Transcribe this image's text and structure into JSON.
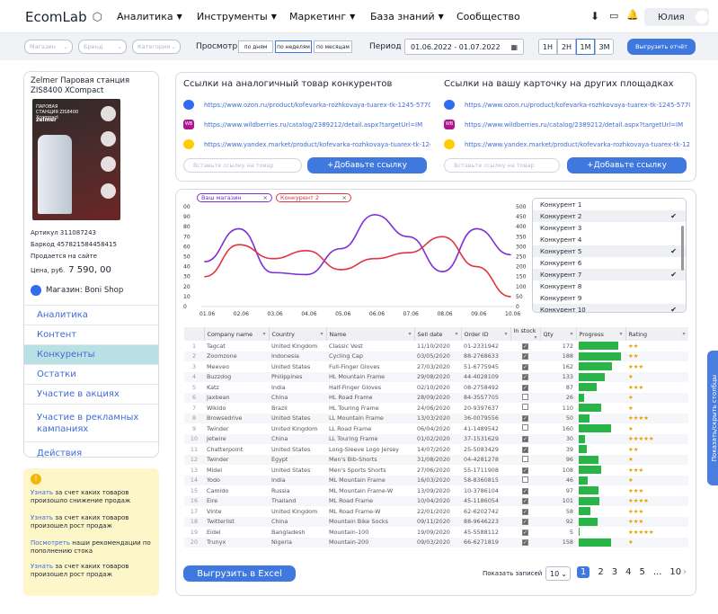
{
  "app": {
    "logo": "EcomLab",
    "user": "Юлия"
  },
  "nav": [
    "Аналитика",
    "Инструменты",
    "Маркетинг",
    "База знаний",
    "Сообщество"
  ],
  "filters": {
    "shop": "Магазин",
    "brand": "Бренд",
    "category": "Категория",
    "view_label": "Просмотр",
    "view": [
      "по дням",
      "по неделям",
      "по месяцам"
    ],
    "period_label": "Период",
    "period": "01.06.2022 - 01.07.2022",
    "ranges": [
      "1Н",
      "2Н",
      "1М",
      "3М"
    ],
    "export": "Выгрузить отчёт"
  },
  "product": {
    "title": "Zelmer Паровая станция ZIS8400 XCompact",
    "image_title": "ПАРОВАЯ СТАНЦИЯ ZIS8400 Xcompact",
    "sku": "Артикул 311087243",
    "barcode": "Баркод 457821584458415",
    "site": "Продается на сайте",
    "price_label": "Цена, руб.",
    "price": "7 590, 00",
    "shop_label": "Магазин: Boni Shop"
  },
  "menu": [
    "Аналитика",
    "Контент",
    "Конкуренты",
    "Остатки",
    "Участие в акциях",
    "Участие в рекламных кампаниях",
    "Действия"
  ],
  "tips": [
    {
      "link": "Узнать",
      "text": " за счет каких товаров произошло снижение продаж"
    },
    {
      "link": "Узнать",
      "text": " за счет каких товаров произошел рост продаж"
    },
    {
      "link": "Посмотреть",
      "text": " наши рекомендации по пополнению стока"
    },
    {
      "link": "Узнать",
      "text": " за счет каких товаров произошел рост продаж"
    }
  ],
  "links": {
    "competitors": {
      "title": "Ссылки на аналогичный товар конкурентов",
      "urls": [
        "https://www.ozon.ru/product/kofevarka-rozhkovaya-tuarex-tk-1245-577062...",
        "https://www.wildberries.ru/catalog/2389212/detail.aspx?targetUrl=IM",
        "https://www.yandex.market/product/kofevarka-rozhkovaya-tuarex-tk-1245..."
      ],
      "placeholder": "Вставьте ссылку на товар",
      "add": "+Добавьте ссылку"
    },
    "ours": {
      "title": "Ссылки на вашу карточку на других площадках",
      "urls": [
        "https://www.ozon.ru/product/kofevarka-rozhkovaya-tuarex-tk-1245-5770...",
        "https://www.wildberries.ru/catalog/2389212/detail.aspx?targetUrl=IM",
        "https://www.yandex.market/product/kofevarka-rozhkovaya-tuarex-tk-124..."
      ],
      "placeholder": "Вставьте ссылку на товар",
      "add": "+Добавьте ссылку"
    }
  },
  "chart_data": {
    "type": "line",
    "legend": [
      "Ваш магазин",
      "Конкурент 2"
    ],
    "x": [
      "01.06",
      "02.06",
      "03.06",
      "04.06",
      "05.06",
      "06.06",
      "07.06",
      "08.06",
      "09.06",
      "10.06"
    ],
    "y_left": [
      "0",
      "10",
      "20",
      "30",
      "40",
      "50",
      "60",
      "70",
      "80",
      "90",
      "00"
    ],
    "y_right": [
      "0",
      "50",
      "100",
      "150",
      "200",
      "250",
      "300",
      "350",
      "400",
      "450",
      "500"
    ],
    "series": [
      {
        "name": "Ваш магазин",
        "color": "#7b2fd6",
        "values": [
          45,
          78,
          34,
          32,
          58,
          92,
          70,
          35,
          78,
          52
        ]
      },
      {
        "name": "Конкурент 2",
        "color": "#e0343e",
        "values": [
          30,
          62,
          48,
          56,
          37,
          48,
          54,
          70,
          40,
          10
        ]
      }
    ]
  },
  "competitor_list": [
    {
      "name": "Конкурент 1",
      "checked": false
    },
    {
      "name": "Конкурент 2",
      "checked": true
    },
    {
      "name": "Конкурент 3",
      "checked": false
    },
    {
      "name": "Конкурент 4",
      "checked": false
    },
    {
      "name": "Конкурент 5",
      "checked": true
    },
    {
      "name": "Конкурент 6",
      "checked": false
    },
    {
      "name": "Конкурент 7",
      "checked": true
    },
    {
      "name": "Конкурент 8",
      "checked": false
    },
    {
      "name": "Конкурент 9",
      "checked": false
    },
    {
      "name": "Конкурент 10",
      "checked": true
    }
  ],
  "table": {
    "headers": [
      "",
      "Company name",
      "Country",
      "Name",
      "Sell date",
      "Order ID",
      "In stock",
      "Qty",
      "Progress",
      "Rating"
    ],
    "rows": [
      [
        "1",
        "Tagcat",
        "United Kingdom",
        "Classic Vest",
        "11/10/2020",
        "01-2331942",
        true,
        "172",
        0.9,
        "★★"
      ],
      [
        "2",
        "Zoomzone",
        "Indonesia",
        "Cycling Cap",
        "03/05/2020",
        "88-2768633",
        true,
        "188",
        0.95,
        "★★"
      ],
      [
        "3",
        "Meeveo",
        "United States",
        "Full-Finger Gloves",
        "27/03/2020",
        "51-6775945",
        true,
        "162",
        0.75,
        "★★★"
      ],
      [
        "4",
        "Buzzdog",
        "Philippines",
        "HL Mountain Frame",
        "29/08/2020",
        "44-4028109",
        true,
        "133",
        0.6,
        "★"
      ],
      [
        "5",
        "Katz",
        "India",
        "Half-Finger Gloves",
        "02/10/2020",
        "08-2758492",
        true,
        "87",
        0.4,
        "★★★"
      ],
      [
        "6",
        "Jaxbean",
        "China",
        "HL Road Frame",
        "28/09/2020",
        "84-3557705",
        false,
        "26",
        0.12,
        "★"
      ],
      [
        "7",
        "Wikido",
        "Brazil",
        "HL Touring Frame",
        "24/06/2020",
        "20-9397637",
        false,
        "110",
        0.5,
        "★"
      ],
      [
        "8",
        "Browsedrive",
        "United States",
        "LL Mountain Frame",
        "13/03/2020",
        "36-0079556",
        true,
        "50",
        0.24,
        "★★★★"
      ],
      [
        "9",
        "Twinder",
        "United Kingdom",
        "LL Road Frame",
        "06/04/2020",
        "41-1489542",
        false,
        "160",
        0.74,
        "★"
      ],
      [
        "10",
        "Jetwire",
        "China",
        "LL Touring Frame",
        "01/02/2020",
        "37-1531629",
        true,
        "30",
        0.14,
        "★★★★★"
      ],
      [
        "11",
        "Chatterpoint",
        "United States",
        "Long-Sleeve Logo Jersey",
        "14/07/2020",
        "25-5083429",
        true,
        "39",
        0.18,
        "★★"
      ],
      [
        "12",
        "Twinder",
        "Egypt",
        "Men's Bib-Shorts",
        "31/08/2020",
        "04-4281278",
        false,
        "96",
        0.45,
        "★"
      ],
      [
        "13",
        "Midel",
        "United States",
        "Men's Sports Shorts",
        "27/06/2020",
        "55-1711908",
        true,
        "108",
        0.5,
        "★★★"
      ],
      [
        "14",
        "Yodo",
        "India",
        "ML Mountain Frame",
        "16/03/2020",
        "58-8360815",
        false,
        "46",
        0.21,
        "★"
      ],
      [
        "15",
        "Camido",
        "Russia",
        "ML Mountain Frame-W",
        "13/09/2020",
        "10-3786104",
        true,
        "97",
        0.45,
        "★★★"
      ],
      [
        "16",
        "Eire",
        "Thailand",
        "ML Road Frame",
        "10/04/2020",
        "45-1186054",
        true,
        "101",
        0.47,
        "★★★★"
      ],
      [
        "17",
        "Vinte",
        "United Kingdom",
        "ML Road Frame-W",
        "22/01/2020",
        "62-6202742",
        true,
        "58",
        0.27,
        "★★★"
      ],
      [
        "18",
        "Twitterlist",
        "China",
        "Mountain Bike Socks",
        "09/11/2020",
        "88-9646223",
        true,
        "92",
        0.43,
        "★★★"
      ],
      [
        "19",
        "Eidel",
        "Bangladesh",
        "Mountain-100",
        "19/09/2020",
        "45-5588112",
        true,
        "5",
        0.03,
        "★★★★★"
      ],
      [
        "20",
        "Trunyx",
        "Nigeria",
        "Mountain-200",
        "09/03/2020",
        "66-6271819",
        true,
        "158",
        0.73,
        "★"
      ]
    ]
  },
  "footer": {
    "excel": "Выгрузить в Excel",
    "per_page_label": "Показать записей",
    "per_page": "10",
    "pages": [
      "1",
      "2",
      "3",
      "4",
      "5",
      "...",
      "10"
    ]
  },
  "side_tab": "Показать/скрыть столбцы"
}
